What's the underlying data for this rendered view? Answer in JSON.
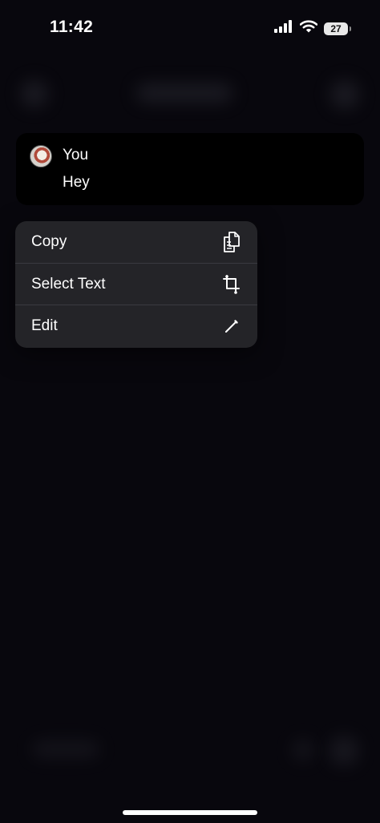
{
  "status_bar": {
    "time": "11:42",
    "battery_level": "27",
    "icons": [
      "cellular-signal-icon",
      "wifi-icon",
      "battery-icon"
    ]
  },
  "message": {
    "author": "You",
    "text": "Hey"
  },
  "context_menu": {
    "items": [
      {
        "label": "Copy",
        "icon": "copy-icon"
      },
      {
        "label": "Select Text",
        "icon": "crop-icon"
      },
      {
        "label": "Edit",
        "icon": "pencil-icon"
      }
    ]
  },
  "colors": {
    "background": "#08070d",
    "menu_background": "#242428",
    "card_background": "#000000",
    "text": "#ffffff"
  }
}
